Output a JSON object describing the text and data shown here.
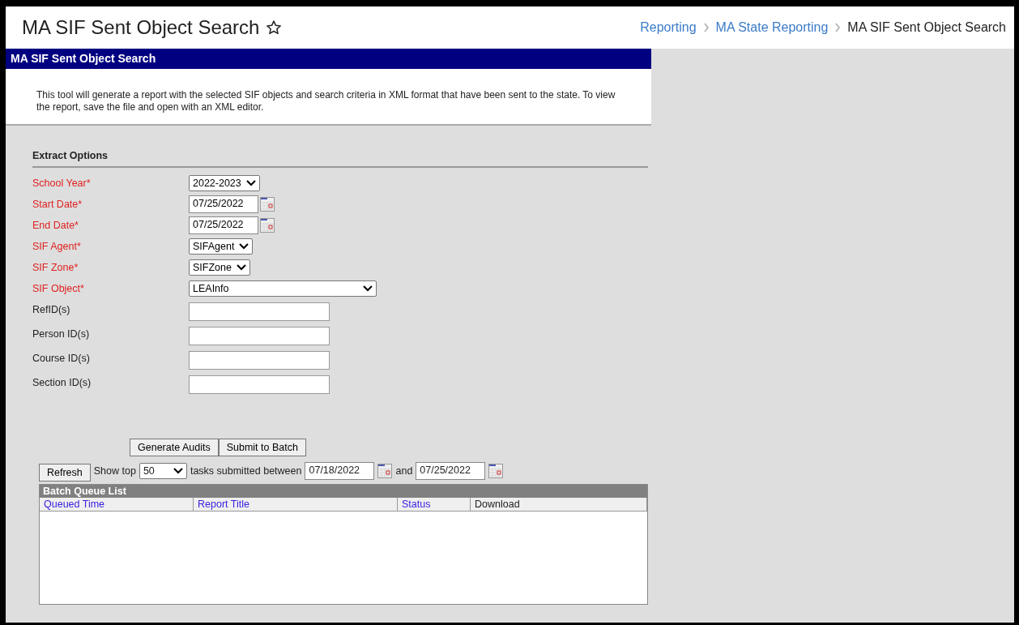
{
  "header": {
    "title": "MA SIF Sent Object Search",
    "breadcrumbs": [
      {
        "label": "Reporting",
        "link": true
      },
      {
        "label": "MA State Reporting",
        "link": true
      },
      {
        "label": "MA SIF Sent Object Search",
        "link": false
      }
    ]
  },
  "panel": {
    "title": "MA SIF Sent Object Search",
    "description": "This tool will generate a report with the selected SIF objects and search criteria in XML format that have been sent to the state. To view the report, save the file and open with an XML editor."
  },
  "extract_options": {
    "title": "Extract Options",
    "fields": [
      {
        "label": "School Year*",
        "required": true,
        "kind": "select",
        "value": "2022-2023"
      },
      {
        "label": "Start Date*",
        "required": true,
        "kind": "date",
        "value": "07/25/2022"
      },
      {
        "label": "End Date*",
        "required": true,
        "kind": "date",
        "value": "07/25/2022"
      },
      {
        "label": "SIF Agent*",
        "required": true,
        "kind": "select",
        "value": "SIFAgent"
      },
      {
        "label": "SIF Zone*",
        "required": true,
        "kind": "select",
        "value": "SIFZone"
      },
      {
        "label": "SIF Object*",
        "required": true,
        "kind": "wideselect",
        "value": "LEAInfo"
      },
      {
        "label": "RefID(s)",
        "required": false,
        "kind": "text"
      },
      {
        "label": "Person ID(s)",
        "required": false,
        "kind": "text"
      },
      {
        "label": "Course ID(s)",
        "required": false,
        "kind": "text"
      },
      {
        "label": "Section ID(s)",
        "required": false,
        "kind": "text"
      }
    ]
  },
  "buttons": [
    "Generate Audits",
    "Submit to Batch"
  ],
  "batch": {
    "refresh": "Refresh",
    "show_top": "Show top",
    "count": "50",
    "between": "tasks submitted between",
    "from": "07/18/2022",
    "and": "and",
    "to": "07/25/2022",
    "table": {
      "title": "Batch Queue List",
      "columns": [
        {
          "label": "Queued Time",
          "sortable": true
        },
        {
          "label": "Report Title",
          "sortable": true
        },
        {
          "label": "Status",
          "sortable": true
        },
        {
          "label": "Download",
          "sortable": false
        }
      ]
    }
  }
}
